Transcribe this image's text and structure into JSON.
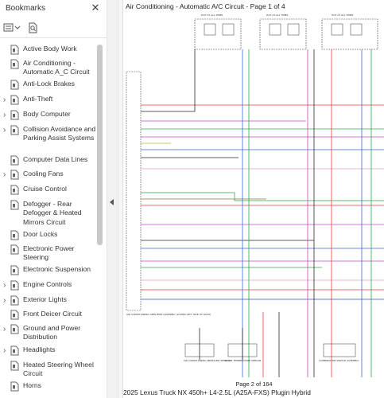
{
  "sidebar": {
    "title": "Bookmarks",
    "close_icon": "close-icon",
    "options_icon": "list-options-icon",
    "find_icon": "find-bookmark-icon",
    "items": [
      {
        "label": "Active Body Work",
        "expandable": false
      },
      {
        "label": "Air Conditioning - Automatic A_C Circuit",
        "expandable": false
      },
      {
        "label": "Anti-Lock Brakes",
        "expandable": false
      },
      {
        "label": "Anti-Theft",
        "expandable": true
      },
      {
        "label": "Body Computer",
        "expandable": true
      },
      {
        "label": "Collision Avoidance and Parking Assist Systems",
        "expandable": true
      },
      {
        "label": "Computer Data Lines",
        "expandable": false
      },
      {
        "label": "Cooling Fans",
        "expandable": true
      },
      {
        "label": "Cruise Control",
        "expandable": false
      },
      {
        "label": "Defogger - Rear Defogger & Heated Mirrors Circuit",
        "expandable": false
      },
      {
        "label": "Door Locks",
        "expandable": false
      },
      {
        "label": "Electronic Power Steering",
        "expandable": false
      },
      {
        "label": "Electronic Suspension",
        "expandable": false
      },
      {
        "label": "Engine Controls",
        "expandable": true
      },
      {
        "label": "Exterior Lights",
        "expandable": true
      },
      {
        "label": "Front Deicer Circuit",
        "expandable": false
      },
      {
        "label": "Ground and Power Distribution",
        "expandable": true
      },
      {
        "label": "Headlights",
        "expandable": true
      },
      {
        "label": "Heated Steering Wheel Circuit",
        "expandable": false
      },
      {
        "label": "Horns",
        "expandable": false
      }
    ]
  },
  "page": {
    "title": "Air Conditioning - Automatic A/C Circuit - Page 1 of 4",
    "page_number": "Page 2 of 164",
    "model": "2025 Lexus Truck NX 450h+ L4-2.5L (A25A-FXS) Plugin Hybrid"
  },
  "diagram": {
    "relay_labels": [
      "HOT AT ALL TIMES",
      "HOT AT ALL TIMES",
      "HOT AT ALL TIMES"
    ],
    "amplifier_label": "AIR CONDITIONING AMPLIFIER ASSEMBLY (LOWER LEFT SIDE OF DASH)",
    "component_labels": [
      "AIR CONDITIONING PRESSURE SENSOR",
      "ROOM TEMPERATURE SENSOR",
      "COMBINATION SWITCH ASSEMBLY"
    ],
    "wire_colors": [
      "#2a2a2a",
      "#e23c3c",
      "#3a66d8",
      "#2fa84a",
      "#cc44cc",
      "#a7c83a",
      "#8a7a3a",
      "#d8a0c8",
      "#3c4fb0"
    ]
  }
}
